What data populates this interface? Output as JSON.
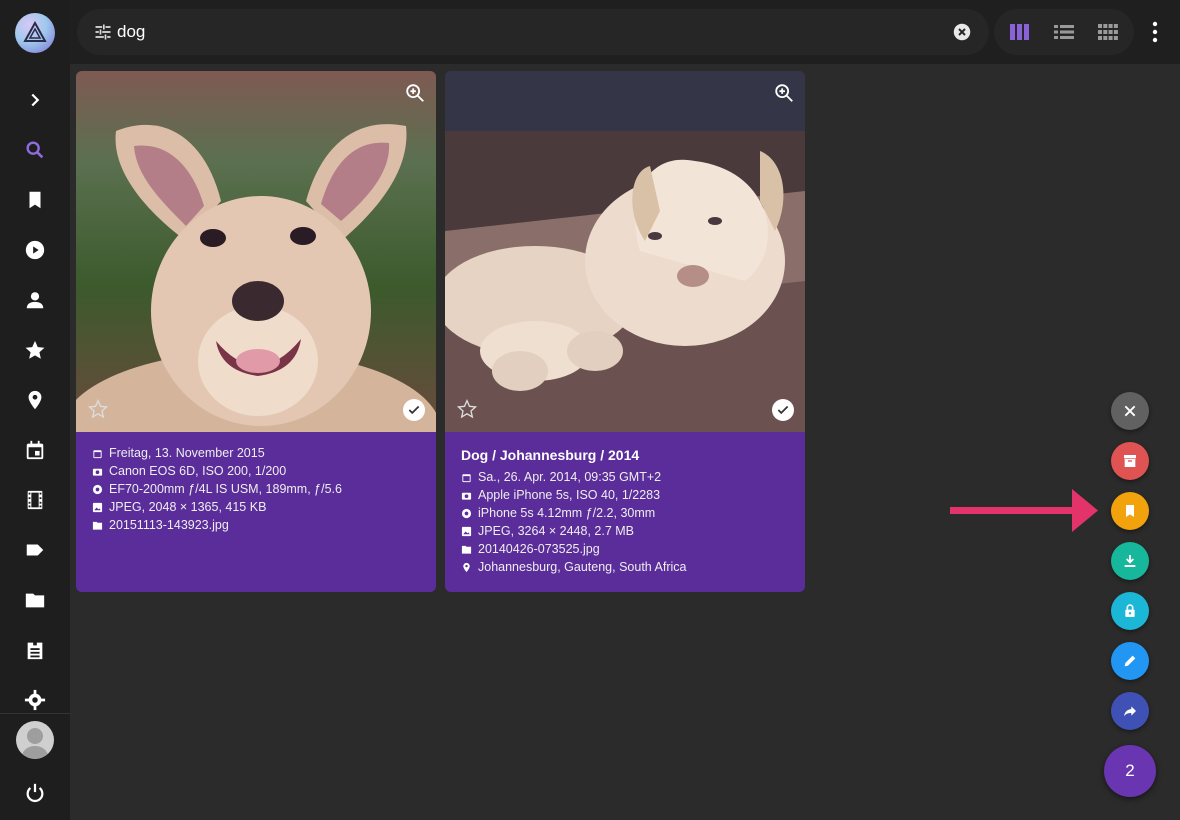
{
  "search": {
    "query": "dog"
  },
  "sidebar": {
    "items": [
      {
        "name": "expand-icon"
      },
      {
        "name": "search-icon"
      },
      {
        "name": "bookmark-icon"
      },
      {
        "name": "play-icon"
      },
      {
        "name": "person-icon"
      },
      {
        "name": "star-icon"
      },
      {
        "name": "place-icon"
      },
      {
        "name": "calendar-icon"
      },
      {
        "name": "film-icon"
      },
      {
        "name": "label-icon"
      },
      {
        "name": "folder-icon"
      },
      {
        "name": "library-icon"
      },
      {
        "name": "settings-icon"
      },
      {
        "name": "power-icon"
      }
    ]
  },
  "cards": [
    {
      "title": "",
      "rows": [
        {
          "icon": "calendar-icon",
          "text": "Freitag, 13. November 2015"
        },
        {
          "icon": "camera-icon",
          "text": "Canon EOS 6D, ISO 200, 1/200"
        },
        {
          "icon": "aperture-icon",
          "text": "EF70-200mm ƒ/4L IS USM, 189mm, ƒ/5.6"
        },
        {
          "icon": "image-icon",
          "text": "JPEG, 2048 × 1365, 415 KB"
        },
        {
          "icon": "file-icon",
          "text": "20151113-143923.jpg"
        }
      ]
    },
    {
      "title": "Dog / Johannesburg / 2014",
      "rows": [
        {
          "icon": "calendar-icon",
          "text": "Sa., 26. Apr. 2014, 09:35 GMT+2"
        },
        {
          "icon": "camera-icon",
          "text": "Apple iPhone 5s, ISO 40, 1/2283"
        },
        {
          "icon": "aperture-icon",
          "text": "iPhone 5s 4.12mm ƒ/2.2, 30mm"
        },
        {
          "icon": "image-icon",
          "text": "JPEG, 3264 × 2448, 2.7 MB"
        },
        {
          "icon": "file-icon",
          "text": "20140426-073525.jpg"
        },
        {
          "icon": "place-icon",
          "text": "Johannesburg, Gauteng, South Africa"
        }
      ]
    }
  ],
  "fab": {
    "count": "2",
    "buttons": [
      {
        "name": "close-icon",
        "color": "#616161"
      },
      {
        "name": "archive-icon",
        "color": "#e05353"
      },
      {
        "name": "bookmark-icon",
        "color": "#f1a20d"
      },
      {
        "name": "download-icon",
        "color": "#17b79b"
      },
      {
        "name": "lock-icon",
        "color": "#1cb6d6"
      },
      {
        "name": "edit-icon",
        "color": "#2196f3"
      },
      {
        "name": "share-icon",
        "color": "#3f51b5"
      }
    ]
  },
  "colors": {
    "accent": "#7e57c2",
    "card_bg": "#5b2d9b",
    "arrow": "#e2336b"
  }
}
